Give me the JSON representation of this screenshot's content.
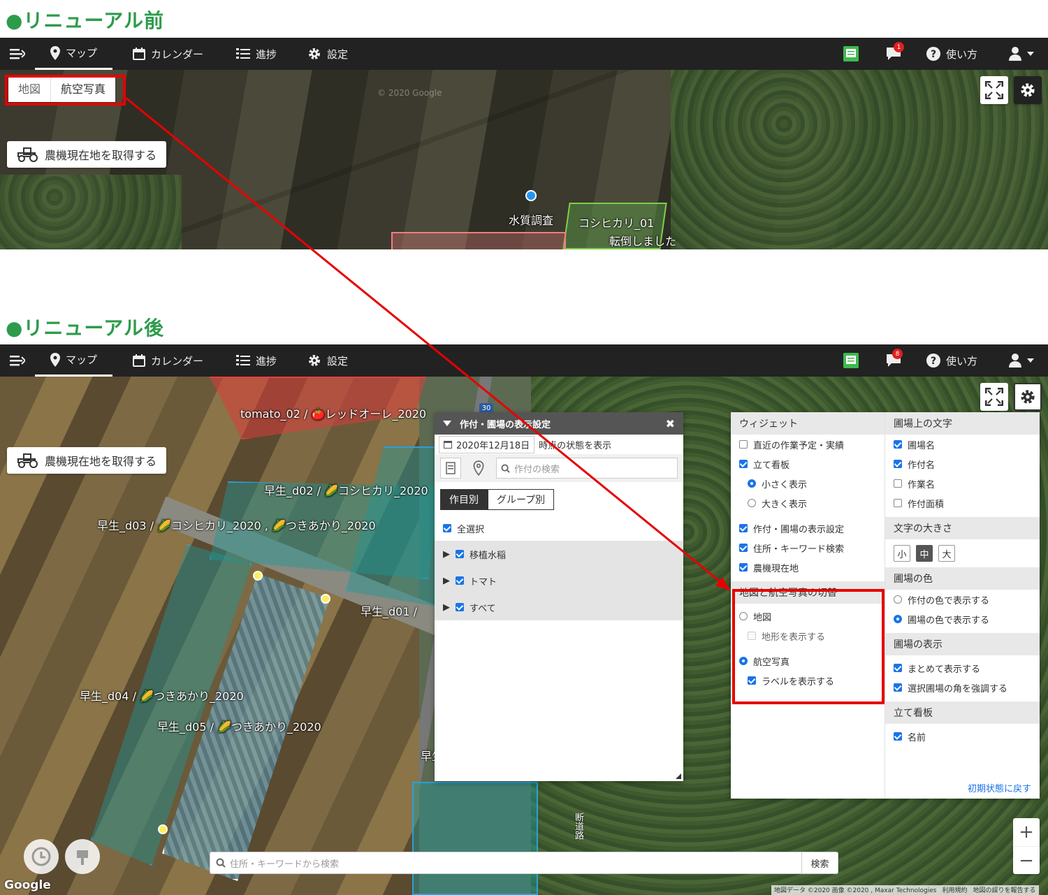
{
  "sections": {
    "before": "●リニューアル前",
    "after": "●リニューアル後"
  },
  "nav": {
    "map": "マップ",
    "calendar": "カレンダー",
    "progress": "進捗",
    "settings": "設定",
    "help": "使い方",
    "badge_before": "1",
    "badge_after": "8"
  },
  "old_map": {
    "tab_map": "地図",
    "tab_aerial": "航空写真",
    "get_machine": "農機現在地を取得する",
    "labels": [
      "水質調査",
      "コシヒカリ_01",
      "転倒しました"
    ],
    "watermark": "© 2020 Google"
  },
  "new_map": {
    "get_machine": "農機現在地を取得する",
    "road_number": "30",
    "road_name": "断道路",
    "labels": [
      "tomato_02 / 🍅レッドオーレ_2020",
      "早生_d02 / 🌽コシヒカリ_2020",
      "早生_d03 / 🌽コシヒカリ_2020 , 🌽つきあかり_2020",
      "早生_d01 /",
      "早生_d04 / 🌽つきあかり_2020",
      "早生_d05 / 🌽つきあかり_2020",
      "早生"
    ],
    "search_placeholder": "住所・キーワードから検索",
    "search_button": "検索",
    "google": "Google",
    "attribution": [
      "地図データ ©2020 画像 ©2020 , Maxar Technologies",
      "利用規約",
      "地図の誤りを報告する"
    ],
    "zoom_in": "+",
    "zoom_out": "−"
  },
  "crop_panel": {
    "title": "作付・圃場の表示設定",
    "date": "2020年12月18日",
    "date_suffix": "時点の状態を表示",
    "search_placeholder": "作付の検索",
    "tab_crop": "作目別",
    "tab_group": "グループ別",
    "select_all": "全選択",
    "groups": [
      "移植水稲",
      "トマト",
      "すべて"
    ]
  },
  "settings_panel": {
    "widget_header": "ウィジェット",
    "widgets": [
      "直近の作業予定・実績",
      "立て看板"
    ],
    "sign_sizes": [
      "小さく表示",
      "大きく表示"
    ],
    "widgets2": [
      "作付・圃場の表示設定",
      "住所・キーワード検索",
      "農機現在地"
    ],
    "switch_header": "地図と航空写真の切替",
    "map_option": "地図",
    "terrain": "地形を表示する",
    "aerial_option": "航空写真",
    "labels_option": "ラベルを表示する",
    "text_header": "圃場上の文字",
    "text_items": [
      "圃場名",
      "作付名",
      "作業名",
      "作付面積"
    ],
    "size_header": "文字の大きさ",
    "sizes": [
      "小",
      "中",
      "大"
    ],
    "color_header": "圃場の色",
    "color_items": [
      "作付の色で表示する",
      "圃場の色で表示する"
    ],
    "display_header": "圃場の表示",
    "display_items": [
      "まとめて表示する",
      "選択圃場の角を強調する"
    ],
    "sign_header": "立て看板",
    "sign_items": [
      "名前"
    ],
    "reset": "初期状態に戻す"
  },
  "colors": {
    "accent_green": "#2e9b4b",
    "navbar": "#222222",
    "highlight_red": "#e60000",
    "checkbox_blue": "#1a73e8"
  }
}
